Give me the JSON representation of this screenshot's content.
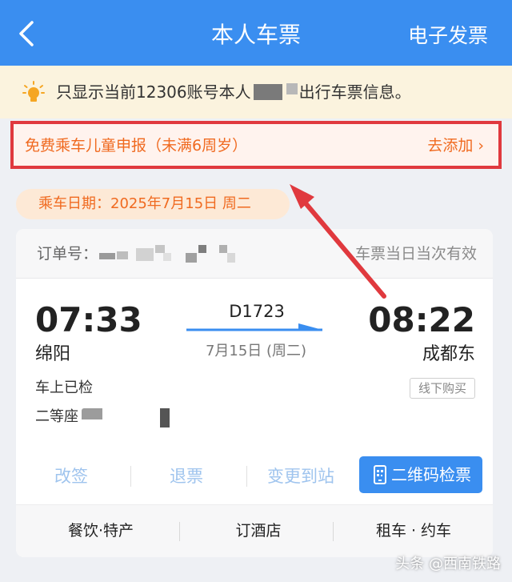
{
  "header": {
    "title": "本人车票",
    "invoice_label": "电子发票"
  },
  "notice": {
    "text_before": "只显示当前12306账号本人",
    "text_after": "出行车票信息。"
  },
  "child_banner": {
    "label": "免费乘车儿童申报（未满6周岁）",
    "action": "去添加 ›"
  },
  "ticket_date": "乘车日期：2025年7月15日 周二",
  "ticket": {
    "order_label": "订单号：",
    "validity": "车票当日当次有效",
    "departure_time": "07:33",
    "departure_station": "绵阳",
    "arrival_time": "08:22",
    "arrival_station": "成都东",
    "train_number": "D1723",
    "date_text": "7月15日 (周二)",
    "status": "车上已检",
    "purchase_type": "线下购买",
    "seat": "二等座"
  },
  "actions": {
    "change": "改签",
    "refund": "退票",
    "change_station": "变更到站",
    "qr_check": "二维码检票"
  },
  "services": {
    "food": "餐饮·特产",
    "hotel": "订酒店",
    "car": "租车 · 约车"
  },
  "watermark": "头条 @西南铁路",
  "colors": {
    "header_blue": "#3a8ef0",
    "accent_orange": "#f06a20",
    "annotation_red": "#e0393e"
  }
}
